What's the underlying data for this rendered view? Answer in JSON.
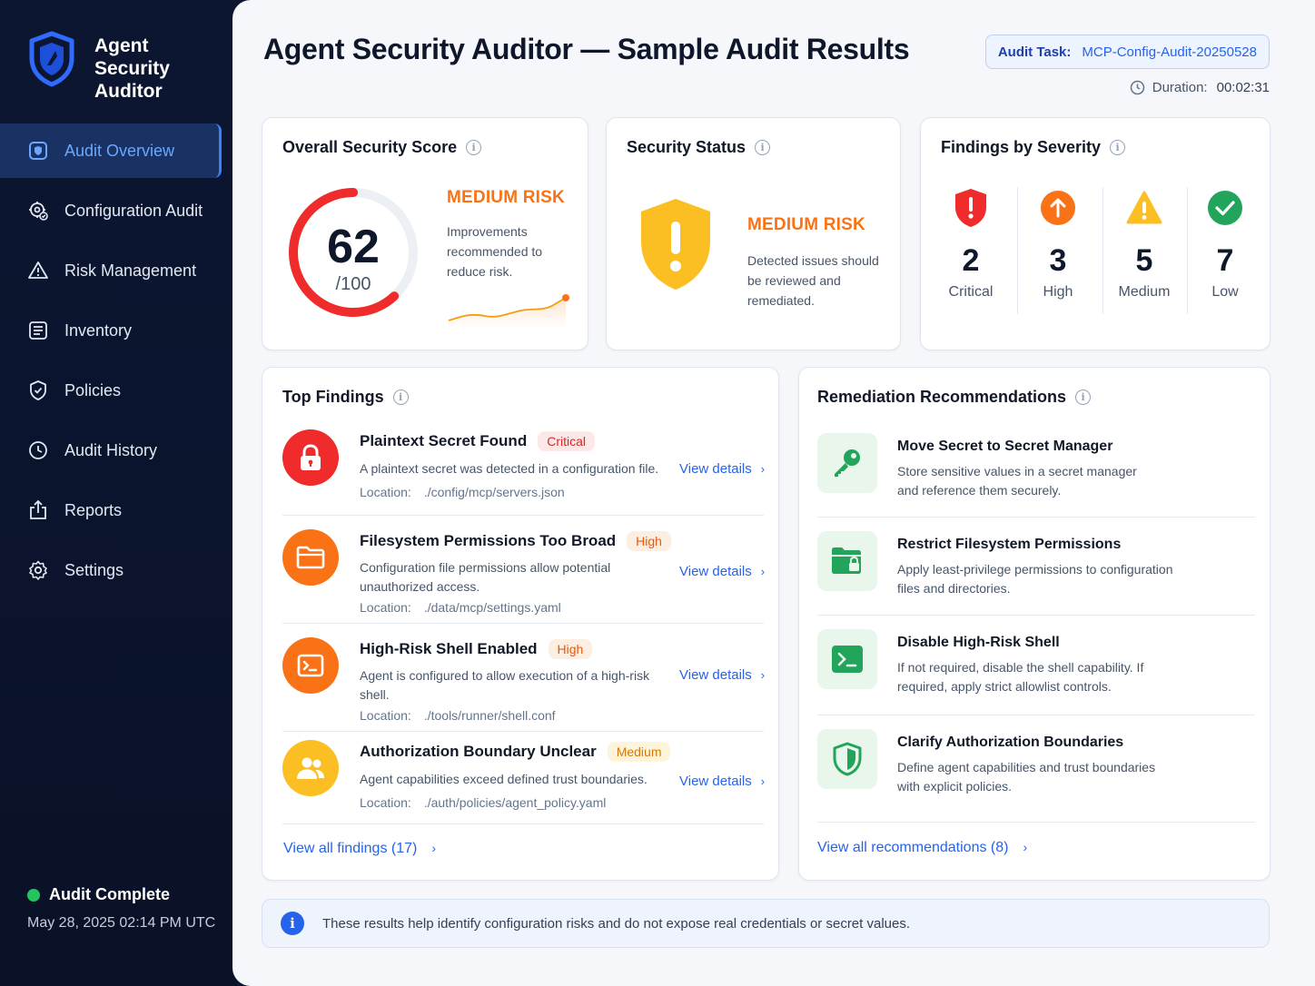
{
  "brand": {
    "line1": "Agent",
    "line2": "Security",
    "line3": "Auditor"
  },
  "nav": [
    {
      "label": "Audit Overview",
      "icon": "audit-overview-icon",
      "active": true
    },
    {
      "label": "Configuration Audit",
      "icon": "configuration-audit-icon"
    },
    {
      "label": "Risk Management",
      "icon": "warning-triangle-icon"
    },
    {
      "label": "Inventory",
      "icon": "inventory-list-icon"
    },
    {
      "label": "Policies",
      "icon": "policies-shield-icon"
    },
    {
      "label": "Audit History",
      "icon": "history-clock-icon"
    },
    {
      "label": "Reports",
      "icon": "share-export-icon"
    },
    {
      "label": "Settings",
      "icon": "gear-icon"
    }
  ],
  "sidebar_status": {
    "label": "Audit Complete",
    "date": "May 28, 2025 02:14 PM UTC",
    "color": "#22c55e"
  },
  "header": {
    "title": "Agent Security Auditor — Sample Audit Results",
    "task_label": "Audit Task:",
    "task_value": "MCP-Config-Audit-20250528",
    "duration_label": "Duration:",
    "duration_value": "00:02:31"
  },
  "score": {
    "title": "Overall Security Score",
    "value": "62",
    "max": "/100",
    "fraction": 0.62,
    "risk": "MEDIUM RISK",
    "desc": "Improvements recommended to reduce risk.",
    "ring_color": "#ef2b2b"
  },
  "status": {
    "title": "Security Status",
    "risk": "MEDIUM RISK",
    "desc": "Detected issues should be reviewed and remediated.",
    "shield_color": "#fbbf24"
  },
  "severity": {
    "title": "Findings by Severity",
    "items": [
      {
        "count": "2",
        "label": "Critical",
        "icon": "critical-shield-icon",
        "color": "#ef2b2b"
      },
      {
        "count": "3",
        "label": "High",
        "icon": "arrow-up-circle-icon",
        "color": "#f97316"
      },
      {
        "count": "5",
        "label": "Medium",
        "icon": "warning-triangle-icon",
        "color": "#fbbf24"
      },
      {
        "count": "7",
        "label": "Low",
        "icon": "check-circle-icon",
        "color": "#22a55b"
      }
    ]
  },
  "findings": {
    "title": "Top Findings",
    "location_label": "Location:",
    "view_label": "View details",
    "items": [
      {
        "title": "Plaintext Secret Found",
        "badge": "Critical",
        "desc": "A plaintext secret was detected in a configuration file.",
        "location": "./config/mcp/servers.json",
        "icon": "lock-icon",
        "color": "#ef2b2b"
      },
      {
        "title": "Filesystem Permissions Too Broad",
        "badge": "High",
        "desc": "Configuration file permissions allow potential unauthorized access.",
        "location": "./data/mcp/settings.yaml",
        "icon": "folder-icon",
        "color": "#f97316"
      },
      {
        "title": "High-Risk Shell Enabled",
        "badge": "High",
        "desc": "Agent is configured to allow execution of a high-risk shell.",
        "location": "./tools/runner/shell.conf",
        "icon": "terminal-icon",
        "color": "#f97316"
      },
      {
        "title": "Authorization Boundary Unclear",
        "badge": "Medium",
        "desc": "Agent capabilities exceed defined trust boundaries.",
        "location": "./auth/policies/agent_policy.yaml",
        "icon": "users-icon",
        "color": "#fbbf24"
      }
    ],
    "view_all": "View all findings (17)"
  },
  "recommendations": {
    "title": "Remediation Recommendations",
    "items": [
      {
        "title": "Move Secret to Secret Manager",
        "desc": "Store sensitive values in a secret manager and reference them securely.",
        "icon": "key-icon"
      },
      {
        "title": "Restrict Filesystem Permissions",
        "desc": "Apply least-privilege permissions to configuration files and directories.",
        "icon": "locked-folder-icon"
      },
      {
        "title": "Disable High-Risk Shell",
        "desc": "If not required, disable the shell capability. If required, apply strict allowlist controls.",
        "icon": "terminal-icon"
      },
      {
        "title": "Clarify Authorization Boundaries",
        "desc": "Define agent capabilities and trust boundaries with explicit policies.",
        "icon": "shield-icon"
      }
    ],
    "view_all": "View all recommendations (8)"
  },
  "notice": {
    "text": "These results help identify configuration risks and do not expose real credentials or secret values."
  }
}
